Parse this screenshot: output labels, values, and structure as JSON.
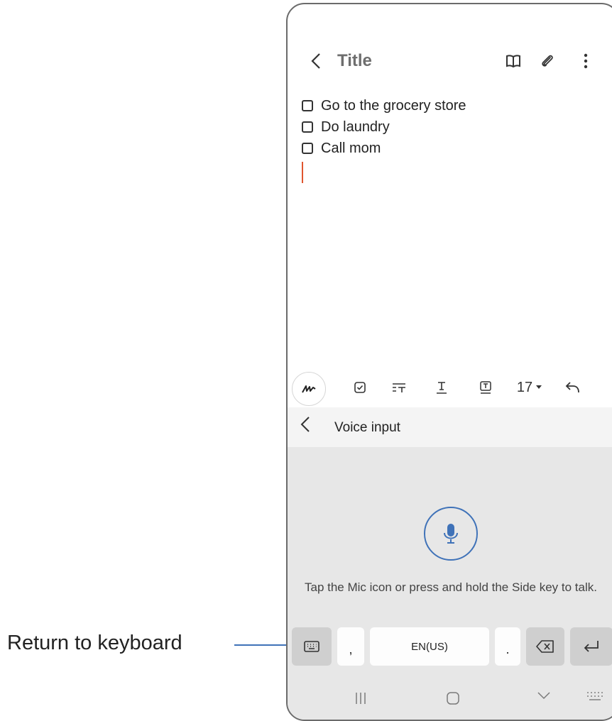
{
  "header": {
    "title": "Title"
  },
  "note": {
    "checklist": [
      {
        "text": "Go to the grocery store"
      },
      {
        "text": "Do laundry"
      },
      {
        "text": "Call mom"
      }
    ]
  },
  "toolbar": {
    "font_size": "17"
  },
  "voice_panel": {
    "label": "Voice input",
    "hint": "Tap the Mic icon or press and hold the Side key to talk."
  },
  "keyboard": {
    "comma": ",",
    "space_label": "EN(US)",
    "period": "."
  },
  "callout": {
    "label": "Return to keyboard"
  },
  "colors": {
    "accent_blue": "#3f72b8",
    "cursor": "#e0552f",
    "panel_gray": "#e7e7e7"
  }
}
